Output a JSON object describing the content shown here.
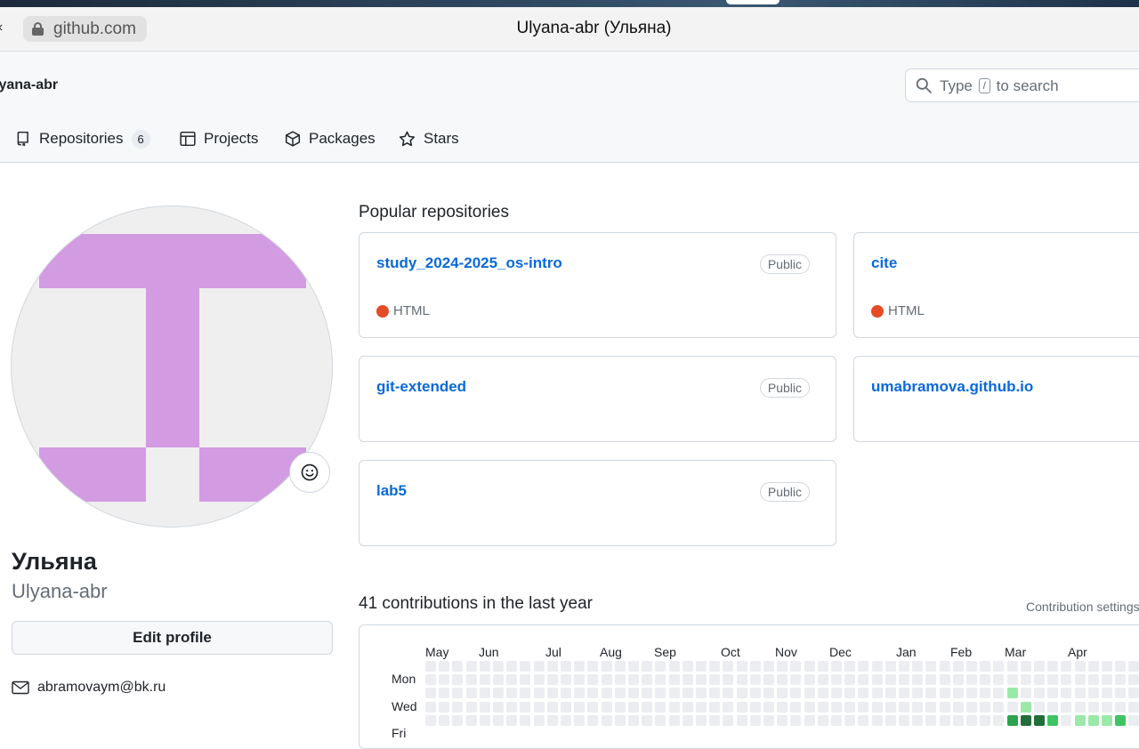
{
  "browser": {
    "url": "github.com",
    "window_title": "Ulyana-abr (Ульяна)"
  },
  "header": {
    "username": "lyana-abr",
    "search": {
      "before": "Type",
      "key": "/",
      "after": "to search"
    },
    "tabs": [
      {
        "label": "Repositories",
        "count": "6",
        "icon": "repo-icon"
      },
      {
        "label": "Projects",
        "icon": "table-icon"
      },
      {
        "label": "Packages",
        "icon": "package-icon"
      },
      {
        "label": "Stars",
        "icon": "star-icon"
      }
    ]
  },
  "profile": {
    "fullname": "Ульяна",
    "login": "Ulyana-abr",
    "edit_label": "Edit profile",
    "email": "abramovaym@bk.ru",
    "avatar_color": "#d39be2"
  },
  "popular": {
    "title": "Popular repositories",
    "repos": [
      {
        "name": "study_2024-2025_os-intro",
        "badge": "Public",
        "lang": "HTML",
        "lang_color": "#e34c26"
      },
      {
        "name": "cite",
        "badge": "",
        "lang": "HTML",
        "lang_color": "#e34c26"
      },
      {
        "name": "git-extended",
        "badge": "Public",
        "lang": ""
      },
      {
        "name": "umabramova.github.io",
        "badge": "",
        "lang": ""
      },
      {
        "name": "lab5",
        "badge": "Public",
        "lang": ""
      }
    ]
  },
  "contributions": {
    "title": "41 contributions in the last year",
    "settings": "Contribution settings",
    "months": [
      "May",
      "Jun",
      "Jul",
      "Aug",
      "Sep",
      "Oct",
      "Nov",
      "Dec",
      "Jan",
      "Feb",
      "Mar",
      "Apr"
    ],
    "days": [
      "Mon",
      "Wed",
      "Fri"
    ],
    "colors": [
      "#ebedf0",
      "#9be9a8",
      "#40c463",
      "#30a14e",
      "#216e39"
    ]
  }
}
